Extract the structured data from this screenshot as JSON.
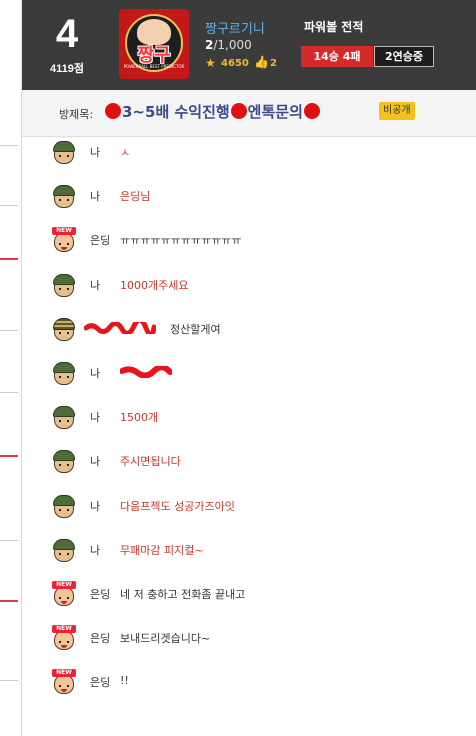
{
  "header": {
    "level": "4",
    "points": "4119점",
    "logo_text": "짱구",
    "logo_sub": "POWERBALL BEST PREDICTOR",
    "room_name": "짱구르기니",
    "participants_current": "2",
    "participants_max": "/1,000",
    "stars": "4650",
    "likes": "2",
    "record_title": "파워볼 전적",
    "record": "14승 4패",
    "streak": "2연승중"
  },
  "subject": {
    "label": "방제목:",
    "part1": "3~5배 수익진행",
    "part2": "엔톡문의",
    "private_badge": "비공개"
  },
  "chat": [
    {
      "avatar": "soldier",
      "nick": "나",
      "msg": "ㅅ"
    },
    {
      "avatar": "soldier",
      "nick": "나",
      "msg": "은딩님"
    },
    {
      "avatar": "new",
      "nick": "은딩",
      "msg": "ㅠㅠㅠㅠㅠㅠㅠㅠㅠㅠㅠㅠ"
    },
    {
      "avatar": "soldier",
      "nick": "나",
      "msg": "1000개주세요"
    },
    {
      "avatar": "rank",
      "nick": "",
      "msg": "정산할게여"
    },
    {
      "avatar": "soldier",
      "nick": "나",
      "msg": ""
    },
    {
      "avatar": "soldier",
      "nick": "나",
      "msg": "1500개"
    },
    {
      "avatar": "soldier",
      "nick": "나",
      "msg": "주시면됩니다"
    },
    {
      "avatar": "soldier",
      "nick": "나",
      "msg": "다음프젝도 성공가즈아잇"
    },
    {
      "avatar": "soldier",
      "nick": "나",
      "msg": "무패마감 피지컬~"
    },
    {
      "avatar": "new",
      "nick": "은딩",
      "msg": "네 저 충하고 전화좀 끝내고"
    },
    {
      "avatar": "new",
      "nick": "은딩",
      "msg": "보내드리겟습니다~"
    },
    {
      "avatar": "new",
      "nick": "은딩",
      "msg": "!!"
    }
  ],
  "colors": {
    "header_bg": "#3b3b3b",
    "accent_red": "#d42a2a",
    "room_name": "#5fb4e8",
    "subject_text": "#3a4a8a",
    "message_red": "#c0392b"
  }
}
